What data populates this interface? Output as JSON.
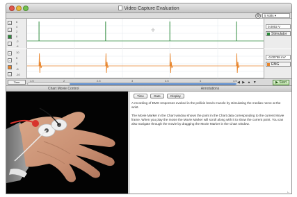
{
  "window": {
    "title": "Video Capture Evaluation"
  },
  "toolbar": {
    "scale_value": "5 Volts ▾"
  },
  "channels": [
    {
      "label": "Stimulator",
      "color": "#2e8b3c",
      "value": "0.0002 V",
      "scale_ticks": [
        "6",
        "4",
        "2",
        "0",
        "-2",
        "-4"
      ],
      "spike_positions": [
        0.05,
        0.33,
        0.6,
        0.88
      ]
    },
    {
      "label": "EMG",
      "color": "#e8852c",
      "value": "-0.00758 mV",
      "scale_ticks": [
        "10",
        "5",
        "0",
        "-5",
        "-10"
      ],
      "spike_positions": [
        0.05,
        0.33,
        0.6,
        0.88
      ]
    }
  ],
  "timeline": {
    "left_button": "Time",
    "ticks": [
      "1.5",
      "2",
      "2.5",
      "3",
      "3.5",
      "4",
      "4.5"
    ],
    "start_label": "▶ Start",
    "icons": "◀ ▶ ▲ ▼"
  },
  "video_pane": {
    "title": "Chart Movie Control"
  },
  "notes_pane": {
    "title": "Annotations",
    "buttons": [
      "Time",
      "Date",
      "Display"
    ],
    "paragraphs": [
      "A recording of EMG responses evoked in the pollicis brevis muscle by stimulating the median nerve at the wrist.",
      "The Movie Marker in the Chart window shows the point in the Chart data corresponding to the current Movie frame. When you play the movie the Movie Marker will scroll along with it to show the current point. You can also navigate through the movie by dragging the Movie Marker in the Chart window."
    ]
  }
}
